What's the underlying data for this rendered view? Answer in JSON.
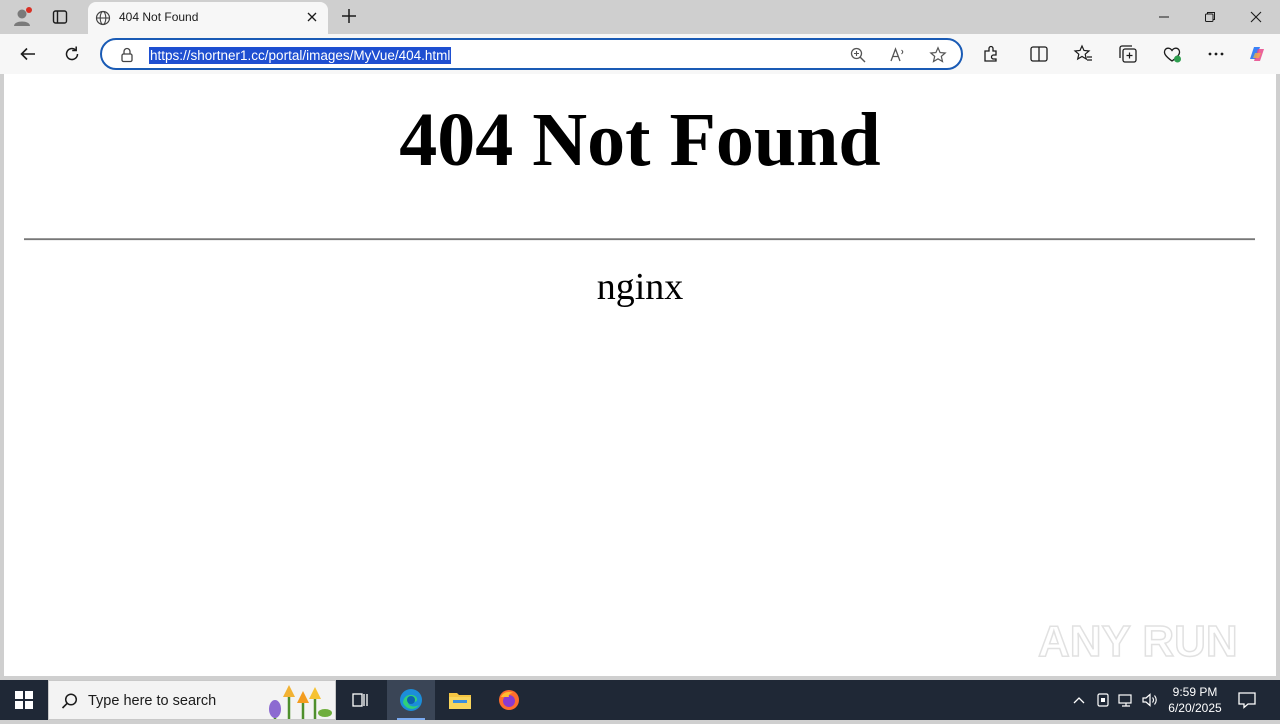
{
  "browser": {
    "tab": {
      "title": "404 Not Found"
    },
    "address_bar": {
      "url": "https://shortner1.cc/portal/images/MyVue/404.html"
    }
  },
  "page": {
    "heading": "404 Not Found",
    "server": "nginx"
  },
  "watermark": {
    "text": "ANY RUN"
  },
  "taskbar": {
    "search_placeholder": "Type here to search",
    "clock_time": "9:59 PM",
    "clock_date": "6/20/2025"
  },
  "colors": {
    "accent": "#1a5bb5",
    "selection": "#1e4fd1",
    "taskbar": "#1f2836"
  }
}
